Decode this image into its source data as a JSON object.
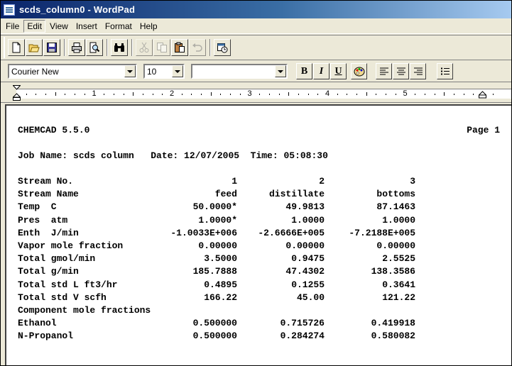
{
  "window": {
    "title": "scds_column0 - WordPad"
  },
  "menu": [
    {
      "label": "File"
    },
    {
      "label": "Edit"
    },
    {
      "label": "View"
    },
    {
      "label": "Insert"
    },
    {
      "label": "Format"
    },
    {
      "label": "Help"
    }
  ],
  "toolbar": {
    "icons": [
      "new-icon",
      "open-icon",
      "save-icon",
      "print-icon",
      "print-preview-icon",
      "find-icon",
      "cut-icon",
      "copy-icon",
      "paste-icon",
      "undo-icon",
      "insert-datetime-icon"
    ]
  },
  "format": {
    "font": "Courier New",
    "size": "10",
    "script": "",
    "bold": "B",
    "italic": "I",
    "underline": "U"
  },
  "ruler": {
    "numbers": [
      "1",
      "2",
      "3",
      "4",
      "5"
    ]
  },
  "document": {
    "header_left": "CHEMCAD 5.5.0",
    "header_right": "Page 1",
    "job_line": "Job Name: scds column   Date: 12/07/2005  Time: 05:08:30",
    "rows": [
      {
        "label": "Stream No.",
        "v1": "1",
        "v2": "2",
        "v3": "3"
      },
      {
        "label": "Stream Name",
        "v1": "feed",
        "v2": "distillate",
        "v3": "bottoms"
      },
      {
        "label": "Temp  C",
        "v1": "50.0000*",
        "v2": "49.9813",
        "v3": "87.1463"
      },
      {
        "label": "Pres  atm",
        "v1": "1.0000*",
        "v2": "1.0000",
        "v3": "1.0000"
      },
      {
        "label": "Enth  J/min",
        "v1": "-1.0033E+006",
        "v2": "-2.6666E+005",
        "v3": "-7.2188E+005"
      },
      {
        "label": "Vapor mole fraction",
        "v1": "0.00000",
        "v2": "0.00000",
        "v3": "0.00000"
      },
      {
        "label": "Total gmol/min",
        "v1": "3.5000",
        "v2": "0.9475",
        "v3": "2.5525"
      },
      {
        "label": "Total g/min",
        "v1": "185.7888",
        "v2": "47.4302",
        "v3": "138.3586"
      },
      {
        "label": "Total std L ft3/hr",
        "v1": "0.4895",
        "v2": "0.1255",
        "v3": "0.3641"
      },
      {
        "label": "Total std V scfh",
        "v1": "166.22",
        "v2": "45.00",
        "v3": "121.22"
      },
      {
        "label": "Component mole fractions",
        "v1": "",
        "v2": "",
        "v3": ""
      },
      {
        "label": "Ethanol",
        "v1": "0.500000",
        "v2": "0.715726",
        "v3": "0.419918"
      },
      {
        "label": "N-Propanol",
        "v1": "0.500000",
        "v2": "0.284274",
        "v3": "0.580082"
      }
    ]
  }
}
